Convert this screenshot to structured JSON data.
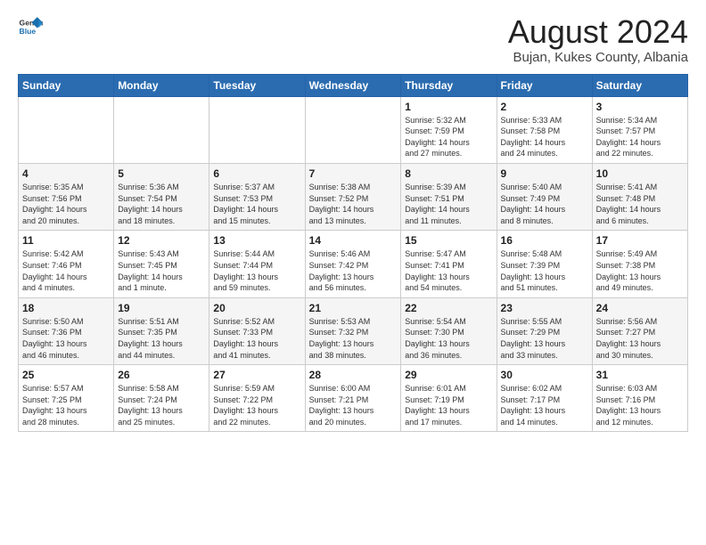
{
  "header": {
    "logo_general": "General",
    "logo_blue": "Blue",
    "title": "August 2024",
    "subtitle": "Bujan, Kukes County, Albania"
  },
  "weekdays": [
    "Sunday",
    "Monday",
    "Tuesday",
    "Wednesday",
    "Thursday",
    "Friday",
    "Saturday"
  ],
  "weeks": [
    [
      {
        "day": "",
        "info": ""
      },
      {
        "day": "",
        "info": ""
      },
      {
        "day": "",
        "info": ""
      },
      {
        "day": "",
        "info": ""
      },
      {
        "day": "1",
        "info": "Sunrise: 5:32 AM\nSunset: 7:59 PM\nDaylight: 14 hours\nand 27 minutes."
      },
      {
        "day": "2",
        "info": "Sunrise: 5:33 AM\nSunset: 7:58 PM\nDaylight: 14 hours\nand 24 minutes."
      },
      {
        "day": "3",
        "info": "Sunrise: 5:34 AM\nSunset: 7:57 PM\nDaylight: 14 hours\nand 22 minutes."
      }
    ],
    [
      {
        "day": "4",
        "info": "Sunrise: 5:35 AM\nSunset: 7:56 PM\nDaylight: 14 hours\nand 20 minutes."
      },
      {
        "day": "5",
        "info": "Sunrise: 5:36 AM\nSunset: 7:54 PM\nDaylight: 14 hours\nand 18 minutes."
      },
      {
        "day": "6",
        "info": "Sunrise: 5:37 AM\nSunset: 7:53 PM\nDaylight: 14 hours\nand 15 minutes."
      },
      {
        "day": "7",
        "info": "Sunrise: 5:38 AM\nSunset: 7:52 PM\nDaylight: 14 hours\nand 13 minutes."
      },
      {
        "day": "8",
        "info": "Sunrise: 5:39 AM\nSunset: 7:51 PM\nDaylight: 14 hours\nand 11 minutes."
      },
      {
        "day": "9",
        "info": "Sunrise: 5:40 AM\nSunset: 7:49 PM\nDaylight: 14 hours\nand 8 minutes."
      },
      {
        "day": "10",
        "info": "Sunrise: 5:41 AM\nSunset: 7:48 PM\nDaylight: 14 hours\nand 6 minutes."
      }
    ],
    [
      {
        "day": "11",
        "info": "Sunrise: 5:42 AM\nSunset: 7:46 PM\nDaylight: 14 hours\nand 4 minutes."
      },
      {
        "day": "12",
        "info": "Sunrise: 5:43 AM\nSunset: 7:45 PM\nDaylight: 14 hours\nand 1 minute."
      },
      {
        "day": "13",
        "info": "Sunrise: 5:44 AM\nSunset: 7:44 PM\nDaylight: 13 hours\nand 59 minutes."
      },
      {
        "day": "14",
        "info": "Sunrise: 5:46 AM\nSunset: 7:42 PM\nDaylight: 13 hours\nand 56 minutes."
      },
      {
        "day": "15",
        "info": "Sunrise: 5:47 AM\nSunset: 7:41 PM\nDaylight: 13 hours\nand 54 minutes."
      },
      {
        "day": "16",
        "info": "Sunrise: 5:48 AM\nSunset: 7:39 PM\nDaylight: 13 hours\nand 51 minutes."
      },
      {
        "day": "17",
        "info": "Sunrise: 5:49 AM\nSunset: 7:38 PM\nDaylight: 13 hours\nand 49 minutes."
      }
    ],
    [
      {
        "day": "18",
        "info": "Sunrise: 5:50 AM\nSunset: 7:36 PM\nDaylight: 13 hours\nand 46 minutes."
      },
      {
        "day": "19",
        "info": "Sunrise: 5:51 AM\nSunset: 7:35 PM\nDaylight: 13 hours\nand 44 minutes."
      },
      {
        "day": "20",
        "info": "Sunrise: 5:52 AM\nSunset: 7:33 PM\nDaylight: 13 hours\nand 41 minutes."
      },
      {
        "day": "21",
        "info": "Sunrise: 5:53 AM\nSunset: 7:32 PM\nDaylight: 13 hours\nand 38 minutes."
      },
      {
        "day": "22",
        "info": "Sunrise: 5:54 AM\nSunset: 7:30 PM\nDaylight: 13 hours\nand 36 minutes."
      },
      {
        "day": "23",
        "info": "Sunrise: 5:55 AM\nSunset: 7:29 PM\nDaylight: 13 hours\nand 33 minutes."
      },
      {
        "day": "24",
        "info": "Sunrise: 5:56 AM\nSunset: 7:27 PM\nDaylight: 13 hours\nand 30 minutes."
      }
    ],
    [
      {
        "day": "25",
        "info": "Sunrise: 5:57 AM\nSunset: 7:25 PM\nDaylight: 13 hours\nand 28 minutes."
      },
      {
        "day": "26",
        "info": "Sunrise: 5:58 AM\nSunset: 7:24 PM\nDaylight: 13 hours\nand 25 minutes."
      },
      {
        "day": "27",
        "info": "Sunrise: 5:59 AM\nSunset: 7:22 PM\nDaylight: 13 hours\nand 22 minutes."
      },
      {
        "day": "28",
        "info": "Sunrise: 6:00 AM\nSunset: 7:21 PM\nDaylight: 13 hours\nand 20 minutes."
      },
      {
        "day": "29",
        "info": "Sunrise: 6:01 AM\nSunset: 7:19 PM\nDaylight: 13 hours\nand 17 minutes."
      },
      {
        "day": "30",
        "info": "Sunrise: 6:02 AM\nSunset: 7:17 PM\nDaylight: 13 hours\nand 14 minutes."
      },
      {
        "day": "31",
        "info": "Sunrise: 6:03 AM\nSunset: 7:16 PM\nDaylight: 13 hours\nand 12 minutes."
      }
    ]
  ]
}
